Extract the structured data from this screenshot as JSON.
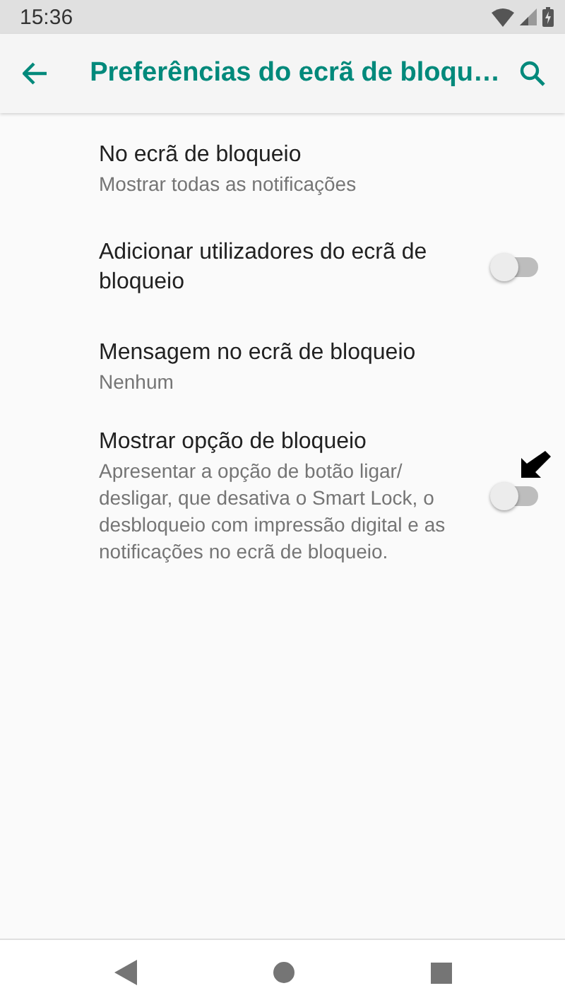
{
  "status_bar": {
    "time": "15:36"
  },
  "toolbar": {
    "title": "Preferências do ecrã de bloqu…"
  },
  "items": [
    {
      "kind": "text",
      "title": "No ecrã de bloqueio",
      "summary": "Mostrar todas as notificações"
    },
    {
      "kind": "switch",
      "title": "Adicionar utilizadores do ecrã de bloqueio",
      "on": false
    },
    {
      "kind": "text",
      "title": "Mensagem no ecrã de bloqueio",
      "summary": "Nenhum"
    },
    {
      "kind": "switch",
      "title": "Mostrar opção de bloqueio",
      "summary": "Apresentar a opção de botão ligar/ desligar, que desativa o Smart Lock, o desbloqueio com impressão digital e as notificações no ecrã de bloqueio.",
      "on": false,
      "pointer": true
    }
  ]
}
